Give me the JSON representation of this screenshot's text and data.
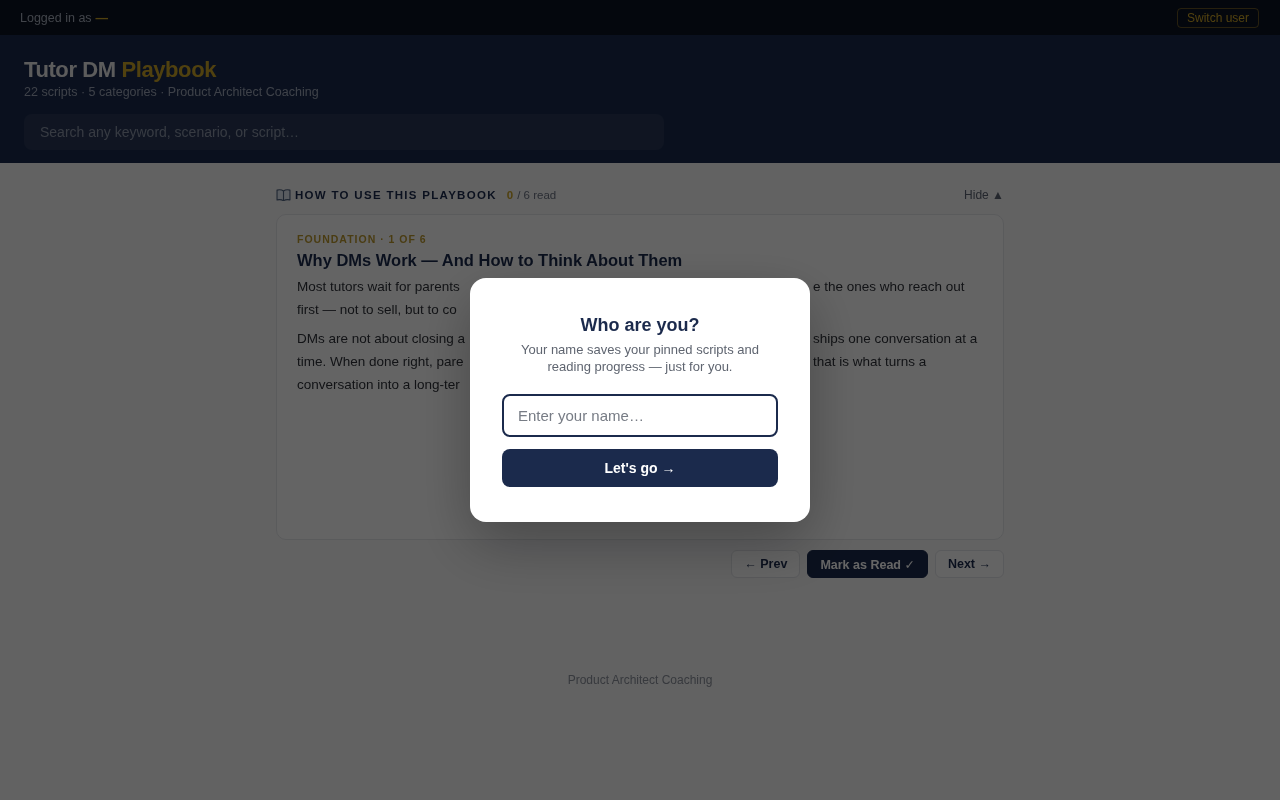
{
  "top_bar": {
    "label": "Logged in as",
    "user": "—",
    "switch_button": "Switch user"
  },
  "header": {
    "title": "Tutor DM",
    "title_accent": "Playbook",
    "subtitle": "22 scripts · 5 categories · Product Architect Coaching",
    "search": {
      "placeholder": "Search any keyword, scenario, or script…"
    }
  },
  "guide": {
    "title": "HOW TO USE THIS PLAYBOOK",
    "read_count": "0",
    "read_total": "/ 6 read",
    "toggle": "Hide ▲",
    "card": {
      "eyebrow": "FOUNDATION · 1 OF 6",
      "heading": "Why DMs Work — And How to Think About Them",
      "paragraphs": [
        {
          "lines": [
            {
              "left": "Most tutors wait for parents",
              "right": "e the ones who reach out"
            },
            {
              "left": "first — not to sell, but to co"
            }
          ]
        },
        {
          "lines": [
            {
              "left": "DMs are not about closing a",
              "right": "ships one conversation at a"
            },
            {
              "left": "time. When done right, pare",
              "right": "that is what turns a"
            },
            {
              "left": "conversation into a long-ter"
            }
          ]
        }
      ]
    },
    "buttons": [
      {
        "label": "← Prev",
        "kind": "secondary"
      },
      {
        "label": "Mark as Read ✓",
        "kind": "primary"
      },
      {
        "label": "Next →",
        "kind": "secondary"
      }
    ]
  },
  "footer": "Product Architect Coaching",
  "modal": {
    "title": "Who are you?",
    "text": "Your name saves your pinned scripts and reading progress — just for you.",
    "name_field": {
      "placeholder": "Enter your name…"
    },
    "button": "Let's go →"
  }
}
